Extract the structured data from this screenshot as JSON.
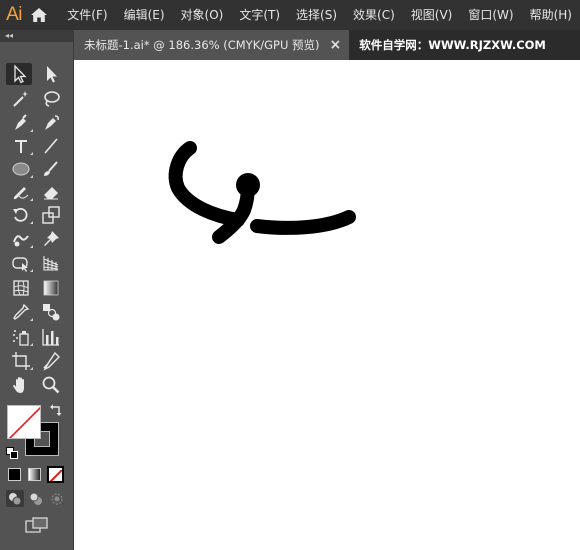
{
  "app": {
    "logo": "Ai"
  },
  "menu": [
    "文件(F)",
    "编辑(E)",
    "对象(O)",
    "文字(T)",
    "选择(S)",
    "效果(C)",
    "视图(V)",
    "窗口(W)",
    "帮助(H)"
  ],
  "tabs": {
    "active": "未标题-1.ai* @ 186.36% (CMYK/GPU 预览)",
    "close": "×",
    "other": "软件自学网：WWW.RJZXW.COM"
  },
  "tools_panel": {
    "collapse": "◂◂"
  },
  "colors": {
    "background": "#535353",
    "menubar": "#323232",
    "logo": "#f7a23b",
    "canvas": "#ffffff",
    "stroke": "#000000"
  }
}
